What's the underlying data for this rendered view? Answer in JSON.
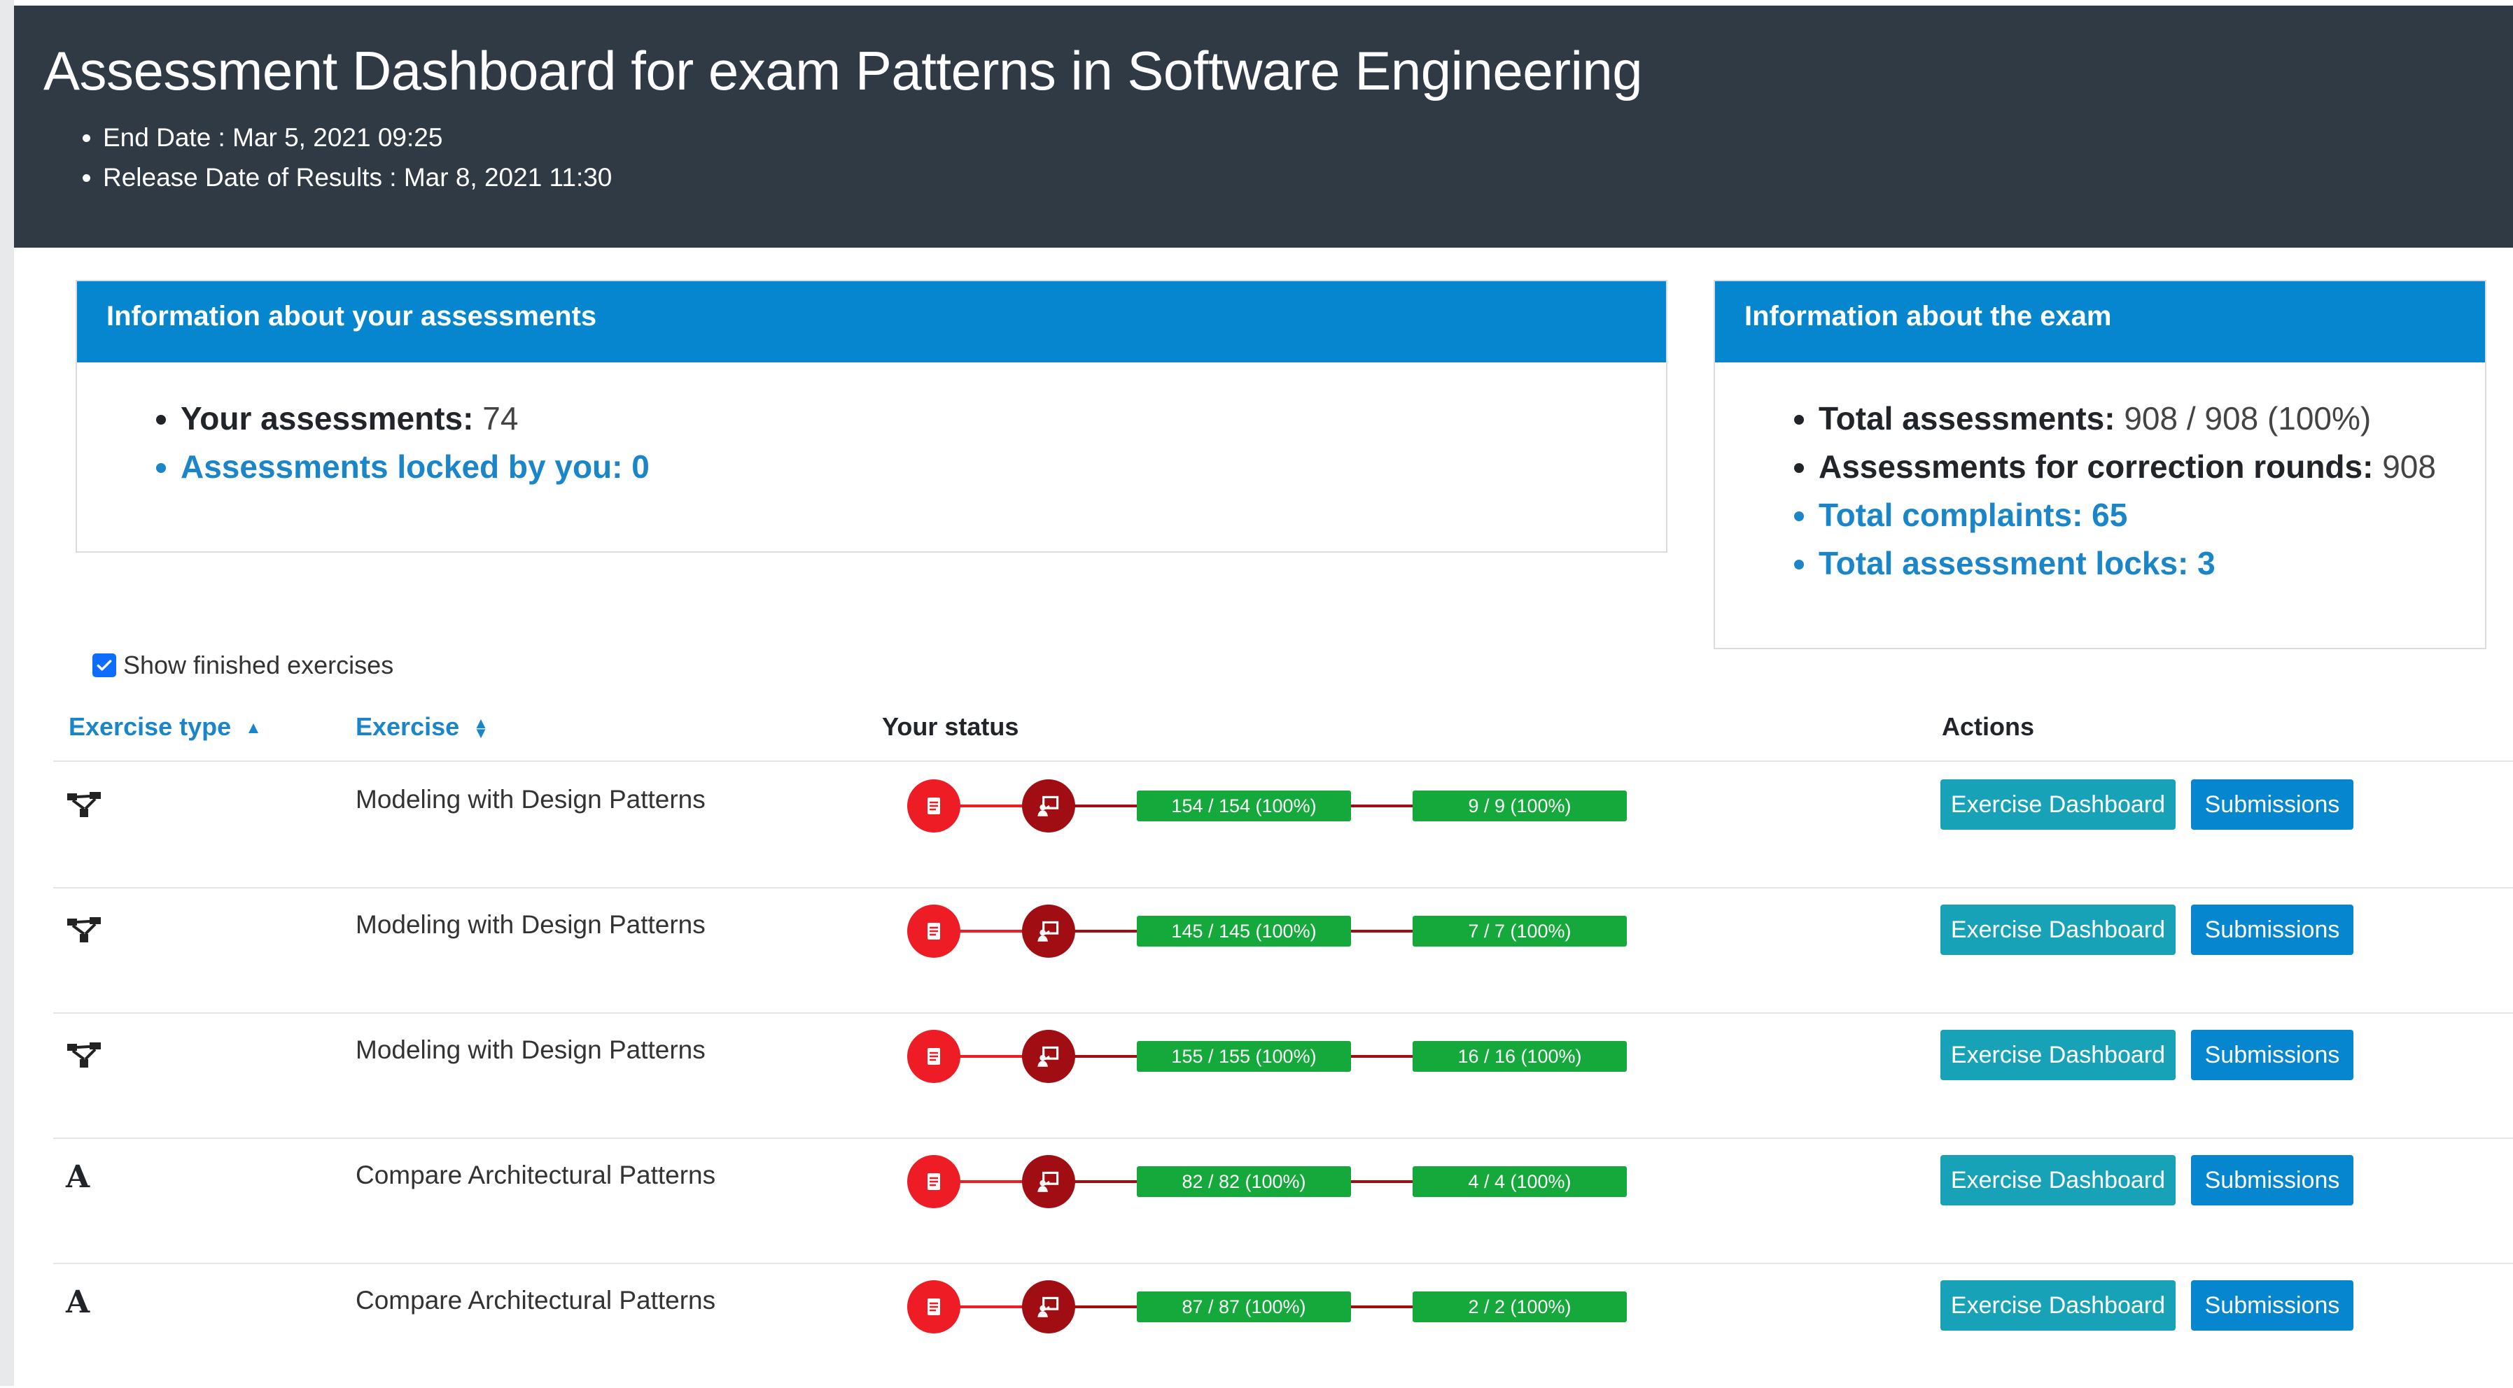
{
  "header": {
    "title": "Assessment Dashboard for exam Patterns in Software Engineering",
    "end_date": "End Date : Mar 5, 2021 09:25",
    "release_date": "Release Date of Results : Mar 8, 2021 11:30"
  },
  "assessments_card": {
    "title": "Information about your assessments",
    "your_assessments_label": "Your assessments:",
    "your_assessments_value": "74",
    "locked_by_you": "Assessments locked by you: 0"
  },
  "exam_card": {
    "title": "Information about the exam",
    "total_assessments_label": "Total assessments:",
    "total_assessments_value": "908 / 908 (100%)",
    "correction_rounds_label": "Assessments for correction rounds:",
    "correction_rounds_value": "908",
    "total_complaints": "Total complaints: 65",
    "total_locks": "Total assessment locks: 3"
  },
  "filter": {
    "show_finished_label": "Show finished exercises",
    "checked": true
  },
  "table": {
    "headers": {
      "exercise_type": "Exercise type",
      "exercise": "Exercise",
      "your_status": "Your status",
      "actions": "Actions"
    },
    "rows": [
      {
        "type_icon": "modeling-diagram-icon",
        "type_letter": "",
        "name": "Modeling with Design Patterns",
        "round1": "154 / 154 (100%)",
        "round2": "9 / 9 (100%)",
        "dashboard_label": "Exercise Dashboard",
        "submissions_label": "Submissions"
      },
      {
        "type_icon": "modeling-diagram-icon",
        "type_letter": "",
        "name": "Modeling with Design Patterns",
        "round1": "145 / 145 (100%)",
        "round2": "7 / 7 (100%)",
        "dashboard_label": "Exercise Dashboard",
        "submissions_label": "Submissions"
      },
      {
        "type_icon": "modeling-diagram-icon",
        "type_letter": "",
        "name": "Modeling with Design Patterns",
        "round1": "155 / 155 (100%)",
        "round2": "16 / 16 (100%)",
        "dashboard_label": "Exercise Dashboard",
        "submissions_label": "Submissions"
      },
      {
        "type_icon": "text-exercise-icon",
        "type_letter": "A",
        "name": "Compare Architectural Patterns",
        "round1": "82 / 82 (100%)",
        "round2": "4 / 4 (100%)",
        "dashboard_label": "Exercise Dashboard",
        "submissions_label": "Submissions"
      },
      {
        "type_icon": "text-exercise-icon",
        "type_letter": "A",
        "name": "Compare Architectural Patterns",
        "round1": "87 / 87 (100%)",
        "round2": "2 / 2 (100%)",
        "dashboard_label": "Exercise Dashboard",
        "submissions_label": "Submissions"
      }
    ]
  },
  "colors": {
    "header_bg": "#2f3a45",
    "card_header_bg": "#0586cf",
    "link": "#1a85c8",
    "dashboard_button": "#17a2b8",
    "submissions_button": "#0586cf",
    "progress_green": "#15a83a",
    "step_red": "#ee1c24",
    "step_dark_red": "#a00e14"
  }
}
